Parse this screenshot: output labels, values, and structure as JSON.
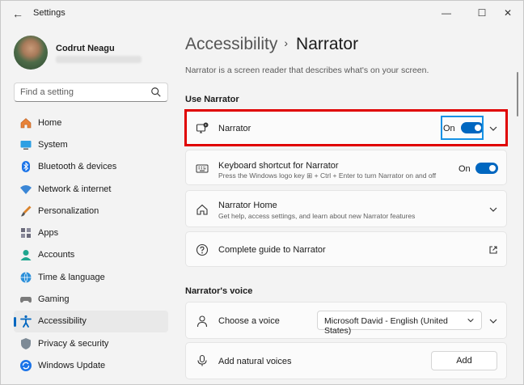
{
  "app": {
    "title": "Settings",
    "back": "←",
    "minimize": "—",
    "maximize": "☐",
    "close": "✕"
  },
  "user": {
    "name": "Codrut Neagu"
  },
  "search": {
    "placeholder": "Find a setting"
  },
  "nav": [
    {
      "label": "Home",
      "icon": "home-icon"
    },
    {
      "label": "System",
      "icon": "system-icon"
    },
    {
      "label": "Bluetooth & devices",
      "icon": "bluetooth-icon"
    },
    {
      "label": "Network & internet",
      "icon": "wifi-icon"
    },
    {
      "label": "Personalization",
      "icon": "brush-icon"
    },
    {
      "label": "Apps",
      "icon": "apps-icon"
    },
    {
      "label": "Accounts",
      "icon": "accounts-icon"
    },
    {
      "label": "Time & language",
      "icon": "globe-icon"
    },
    {
      "label": "Gaming",
      "icon": "gaming-icon"
    },
    {
      "label": "Accessibility",
      "icon": "accessibility-icon",
      "selected": true
    },
    {
      "label": "Privacy & security",
      "icon": "shield-icon"
    },
    {
      "label": "Windows Update",
      "icon": "update-icon"
    }
  ],
  "breadcrumb": {
    "parent": "Accessibility",
    "separator": "›",
    "current": "Narrator"
  },
  "description": "Narrator is a screen reader that describes what's on your screen.",
  "sections": {
    "use": "Use Narrator",
    "voice": "Narrator's voice"
  },
  "cards": {
    "narrator": {
      "title": "Narrator",
      "state": "On"
    },
    "shortcut": {
      "title": "Keyboard shortcut for Narrator",
      "subtitle": "Press the Windows logo key ⊞ + Ctrl + Enter to turn Narrator on and off",
      "state": "On"
    },
    "home": {
      "title": "Narrator Home",
      "subtitle": "Get help, access settings, and learn about new Narrator features"
    },
    "guide": {
      "title": "Complete guide to Narrator"
    },
    "voice": {
      "title": "Choose a voice",
      "selected": "Microsoft David - English (United States)"
    },
    "natural": {
      "title": "Add natural voices",
      "button": "Add"
    }
  },
  "colors": {
    "accent": "#0067c0",
    "highlight_red": "#e00000",
    "highlight_blue": "#1591e5"
  }
}
